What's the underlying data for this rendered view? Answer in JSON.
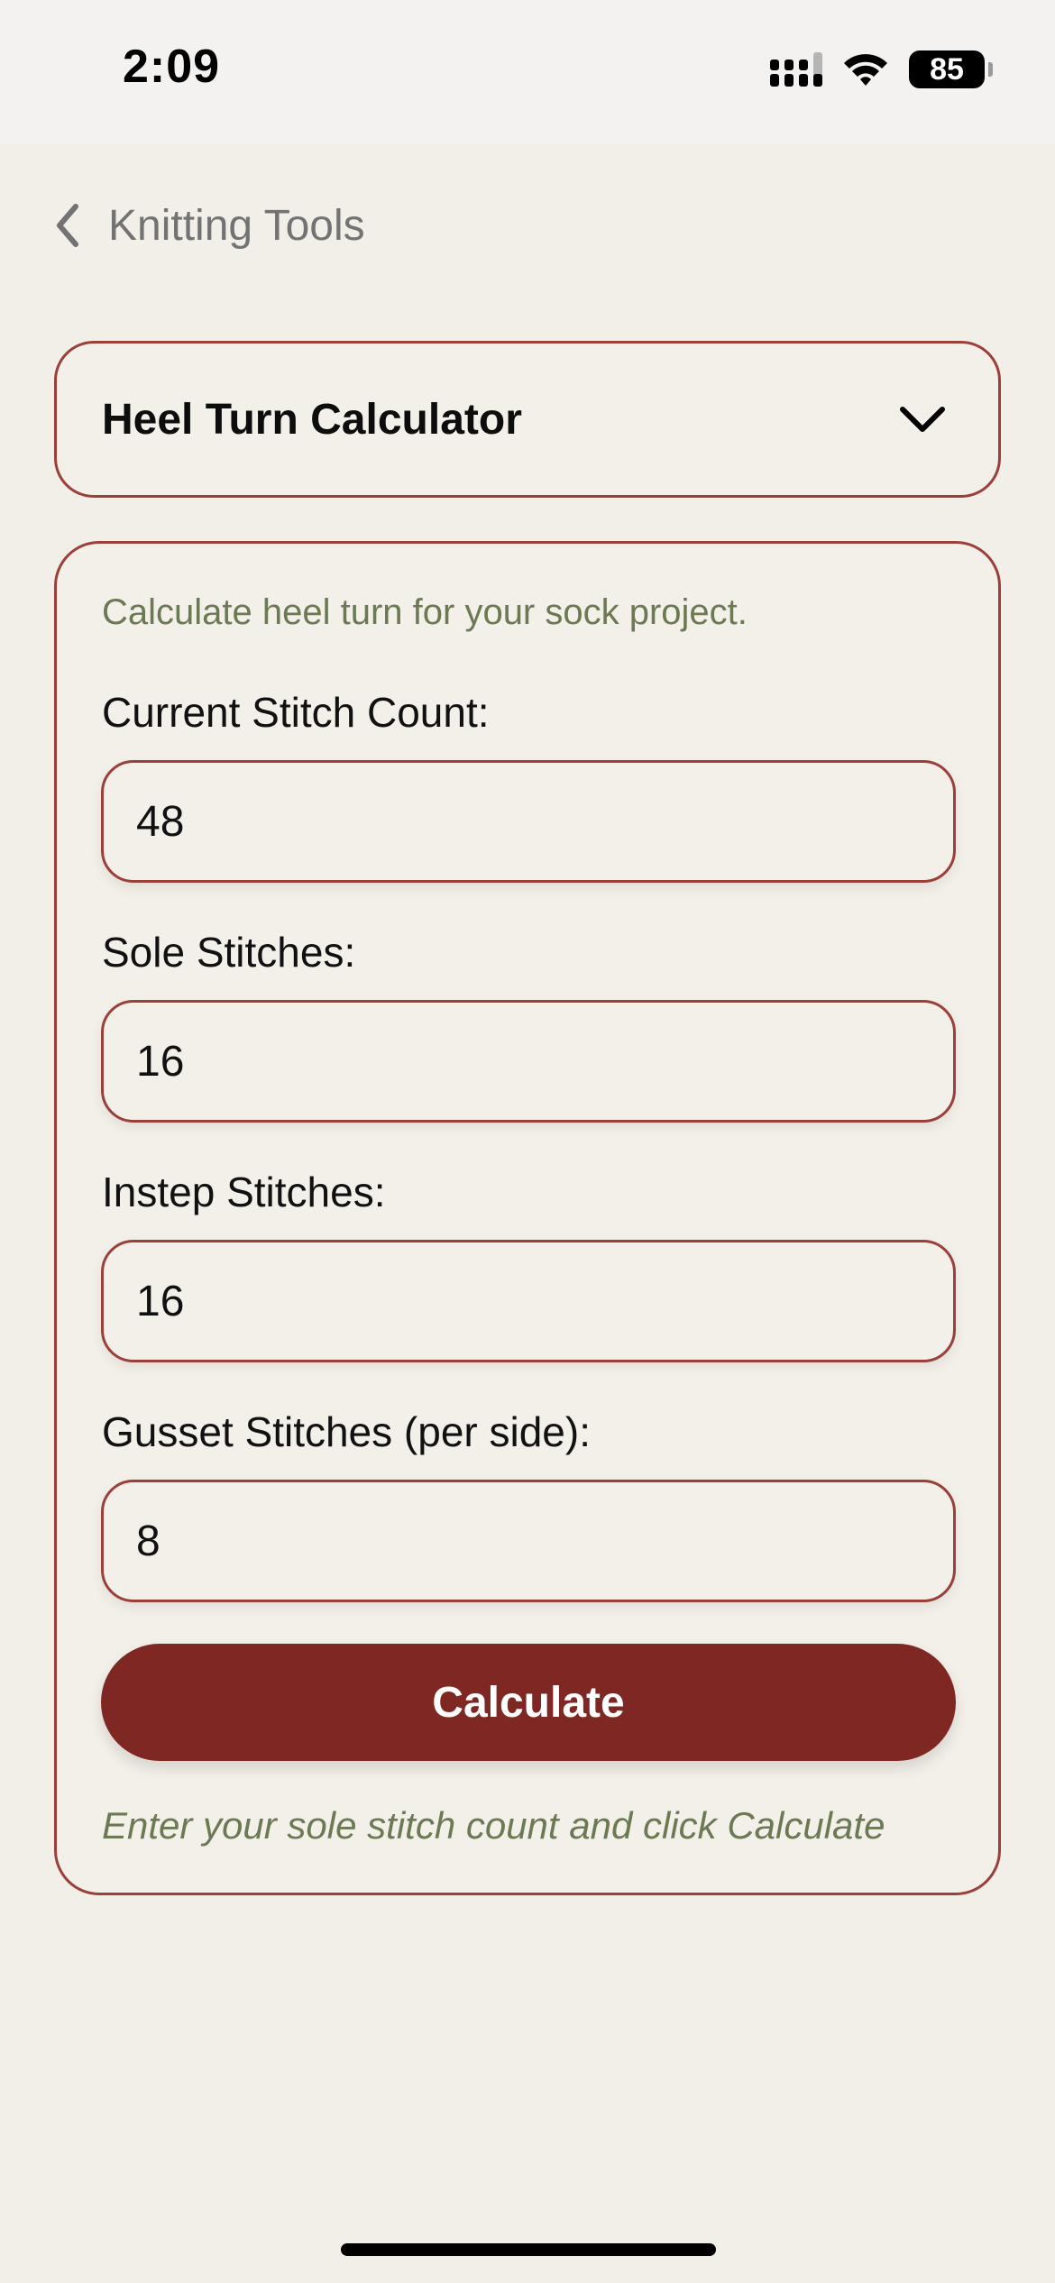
{
  "status_bar": {
    "time": "2:09",
    "battery_level": "85",
    "icons": [
      "cellular-signal-icon",
      "wifi-icon",
      "battery-icon"
    ]
  },
  "nav": {
    "back_label": "Knitting Tools",
    "back_icon": "chevron-left-icon"
  },
  "tool_selector": {
    "selected": "Heel Turn Calculator",
    "icon": "chevron-down-icon"
  },
  "calculator": {
    "intro": "Calculate heel turn for your sock project.",
    "fields": [
      {
        "label": "Current Stitch Count:",
        "value": "48"
      },
      {
        "label": "Sole Stitches:",
        "value": "16"
      },
      {
        "label": "Instep Stitches:",
        "value": "16"
      },
      {
        "label": "Gusset Stitches (per side):",
        "value": "8"
      }
    ],
    "button_label": "Calculate",
    "result_hint": "Enter your sole stitch count and click Calculate"
  },
  "colors": {
    "accent": "#7e2723",
    "border": "#9a4038",
    "background": "#f2efe9",
    "hint_text": "#6b7a52"
  }
}
